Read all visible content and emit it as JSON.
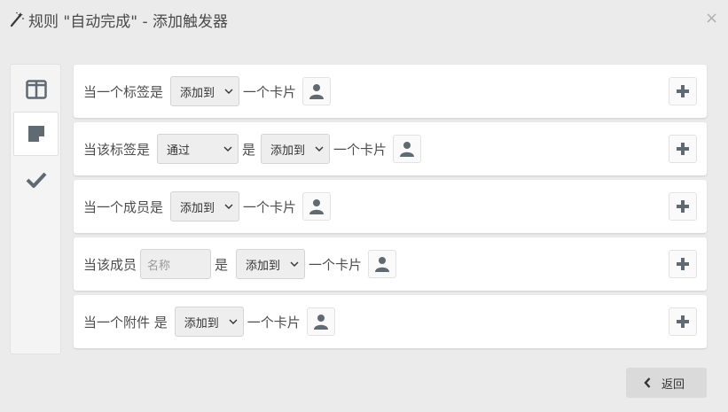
{
  "header": {
    "title": "规则 \"自动完成\" - 添加触发器",
    "icon": "magic-wand-icon",
    "close_icon": "close-icon"
  },
  "sidebar": {
    "tabs": [
      {
        "name": "board-columns-tab",
        "icon": "columns-icon",
        "active": false
      },
      {
        "name": "card-tab",
        "icon": "sticky-note-icon",
        "active": true
      },
      {
        "name": "checklist-tab",
        "icon": "check-icon",
        "active": false
      }
    ]
  },
  "triggers": [
    {
      "label": "当一个标签是",
      "select": "添加到",
      "tail": "一个卡片"
    },
    {
      "label": "当该标签是",
      "select1": "通过",
      "mid": "是",
      "select2": "添加到",
      "tail": "一个卡片"
    },
    {
      "label": "当一个成员是",
      "select": "添加到",
      "tail": "一个卡片"
    },
    {
      "label": "当该成员",
      "input_placeholder": "名称",
      "mid": "是",
      "select": "添加到",
      "tail": "一个卡片"
    },
    {
      "label": "当一个附件 是",
      "select": "添加到",
      "tail": "一个卡片"
    }
  ],
  "footer": {
    "back_label": "返回"
  },
  "colors": {
    "background": "#ebebeb",
    "panel": "#ffffff",
    "icon": "#5f6a72"
  }
}
